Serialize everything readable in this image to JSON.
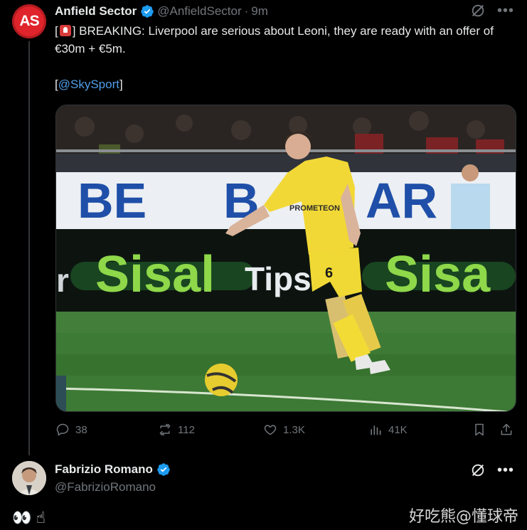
{
  "tweet1": {
    "avatar_text": "AS",
    "author_name": "Anfield Sector",
    "handle": "@AnfieldSector",
    "separator": "·",
    "time": "9m",
    "text_prefix": "[",
    "text_after_emoji": "] BREAKING: Liverpool are serious about Leoni, they are ready with an offer of €30m + €5m.",
    "source_open": "[",
    "source_link": "@SkySport",
    "source_close": "]",
    "image": {
      "board_text_left": "BE",
      "board_text_mid": "B",
      "board_text_right": "AR",
      "sponsor_left": "Sisal",
      "sponsor_tips": "Tips",
      "sponsor_right": "Sisa",
      "sponsor_r": "r",
      "shirt_sponsor": "PROMETEON",
      "shorts_number": "6"
    },
    "metrics": {
      "replies": "38",
      "reposts": "112",
      "likes": "1.3K",
      "views": "41K"
    }
  },
  "tweet2": {
    "author_name": "Fabrizio Romano",
    "handle": "@FabrizioRomano",
    "reply_text": "👀 ☝"
  },
  "watermark": "好吃熊@懂球帝",
  "colors": {
    "background": "#000000",
    "text": "#e7e9ea",
    "muted": "#71767b",
    "link": "#4f9ee8",
    "verified": "#1d9bf0",
    "avatar_red": "#e0242b"
  },
  "icons": [
    "verified-badge-icon",
    "grok-icon",
    "more-icon",
    "reply-icon",
    "repost-icon",
    "like-icon",
    "views-icon",
    "bookmark-icon",
    "share-icon"
  ]
}
